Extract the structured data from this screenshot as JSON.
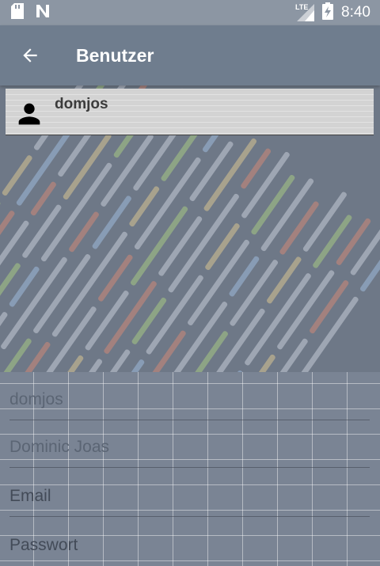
{
  "status_bar": {
    "left_icons": [
      "sd-card-icon",
      "n-notification-icon"
    ],
    "network": "LTE",
    "time": "8:40"
  },
  "app_bar": {
    "back_icon": "arrow-left-icon",
    "title": "Benutzer"
  },
  "users": [
    {
      "name": "domjos",
      "icon": "person-icon"
    }
  ],
  "form": {
    "username_placeholder": "domjos",
    "fullname_placeholder": "Dominic Joas",
    "email_placeholder": "Email",
    "password_placeholder": "Passwort"
  }
}
